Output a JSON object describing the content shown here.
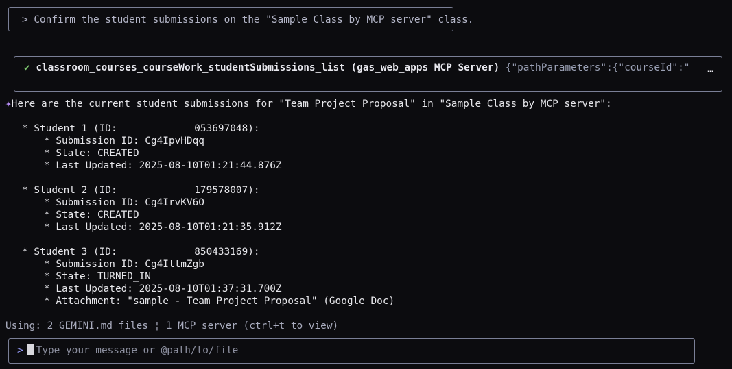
{
  "prompt": {
    "text": "> Confirm the student submissions on the \"Sample Class by MCP server\" class."
  },
  "tool_call": {
    "status_icon": "✔",
    "name": "classroom_courses_courseWork_studentSubmissions_list (gas_web_apps MCP Server)",
    "args": "{\"pathParameters\":{\"courseId\":\"",
    "more": "…"
  },
  "response": {
    "icon": "✦",
    "intro": "Here are the current student submissions for \"Team Project Proposal\" in \"Sample Class by MCP server\":",
    "students": [
      {
        "heading": "* Student 1 (ID:             053697048):",
        "lines": [
          "* Submission ID: Cg4IpvHDqq",
          "* State: CREATED",
          "* Last Updated: 2025-08-10T01:21:44.876Z"
        ]
      },
      {
        "heading": "* Student 2 (ID:             179578007):",
        "lines": [
          "* Submission ID: Cg4IrvKV6O",
          "* State: CREATED",
          "* Last Updated: 2025-08-10T01:21:35.912Z"
        ]
      },
      {
        "heading": "* Student 3 (ID:             850433169):",
        "lines": [
          "* Submission ID: Cg4IttmZgb",
          "* State: TURNED_IN",
          "* Last Updated: 2025-08-10T01:37:31.700Z",
          "* Attachment: \"sample - Team Project Proposal\" (Google Doc)"
        ]
      }
    ]
  },
  "status": {
    "text": "Using: 2 GEMINI.md files ¦ 1 MCP server (ctrl+t to view)"
  },
  "input": {
    "caret": ">",
    "placeholder": "Type your message or @path/to/file"
  }
}
